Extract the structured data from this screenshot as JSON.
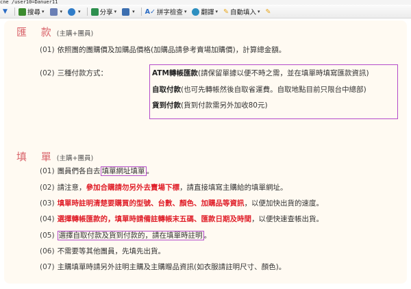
{
  "url": "cne /user10=Danuer11",
  "toolbar": {
    "items": [
      {
        "label": "搜尋",
        "icon": "search-icon",
        "color": "#3b8b2e"
      },
      {
        "label": "",
        "icon": "page-icon",
        "color": "#6a7fb5"
      },
      {
        "label": "",
        "icon": "plus-icon",
        "color": "#2f7cc8"
      },
      {
        "label": "分享",
        "icon": "share-icon",
        "color": "#2d8f4e"
      },
      {
        "label": "",
        "icon": "bookmark-icon",
        "color": "#3c6fb0"
      },
      {
        "label": "拼字檢查",
        "icon": "spellcheck-icon",
        "color": "#2a6bc4"
      },
      {
        "label": "翻譯",
        "icon": "translate-icon",
        "color": "#2d8fc0"
      },
      {
        "label": "自動填入",
        "icon": "autofill-icon",
        "color": "#e8a417"
      },
      {
        "label": "",
        "icon": "pencil-icon",
        "color": "#e8a417"
      }
    ]
  },
  "remit": {
    "title": "匯 款",
    "subtitle": "(主購+團員)",
    "l1_num": "(01)",
    "l1_text": "依照團的團購價及加購品價格(加購品請參考賣場加購價)，計算總金額。",
    "l2_num": "(02)",
    "l2_prefix": "三種付款方式：",
    "atm_strong": "ATM轉帳匯款",
    "atm_note": "(請保留單據以便不時之需，並在填單時填寫匯款資訊)",
    "pickup_strong": "自取付款",
    "pickup_note": "(也可先轉帳然後自取省運費。自取地點目前只限台中總部)",
    "cod_strong": "貨到付款",
    "cod_note": "(貨到付款需另外加收80元)"
  },
  "fill": {
    "title": "填 單",
    "subtitle": "(主購+團員)",
    "l1_num": "(01)",
    "l1_pre": "團員們各自去",
    "l1_box": "填單網址填單",
    "l1_post": "。",
    "l2_num": "(02)",
    "l2_pre": "請注意，",
    "l2_red": "參加合購請勿另外去賣場下標",
    "l2_post": "，請直接填寫主購給的填單網址。",
    "l3_num": "(03)",
    "l3_red": "填單時註明清楚要購買的型號、台數、顏色、加購品等資訊",
    "l3_post": "，以便加快出貨的速度。",
    "l4_num": "(04)",
    "l4_red": "選擇轉帳匯款的，填單時請備註轉帳末五碼、匯款日期及時間",
    "l4_post": "，以便快速查帳出貨。",
    "l5_num": "(05)",
    "l5_box": "選擇自取付款及貨到付款的，請在填單時註明",
    "l5_post": "。",
    "l6_num": "(06)",
    "l6_text": "不需要等其他團員，先填先出貨。",
    "l7_num": "(07)",
    "l7_text": "主購填單時請另外註明主購及主購贈品資訊(如衣服請註明尺寸、顏色)。"
  },
  "colors": {
    "accent_title": "#d9646b",
    "highlight_red": "#e0202a",
    "box_border": "#b44ac9",
    "panel_bg": "#fffaf2"
  }
}
